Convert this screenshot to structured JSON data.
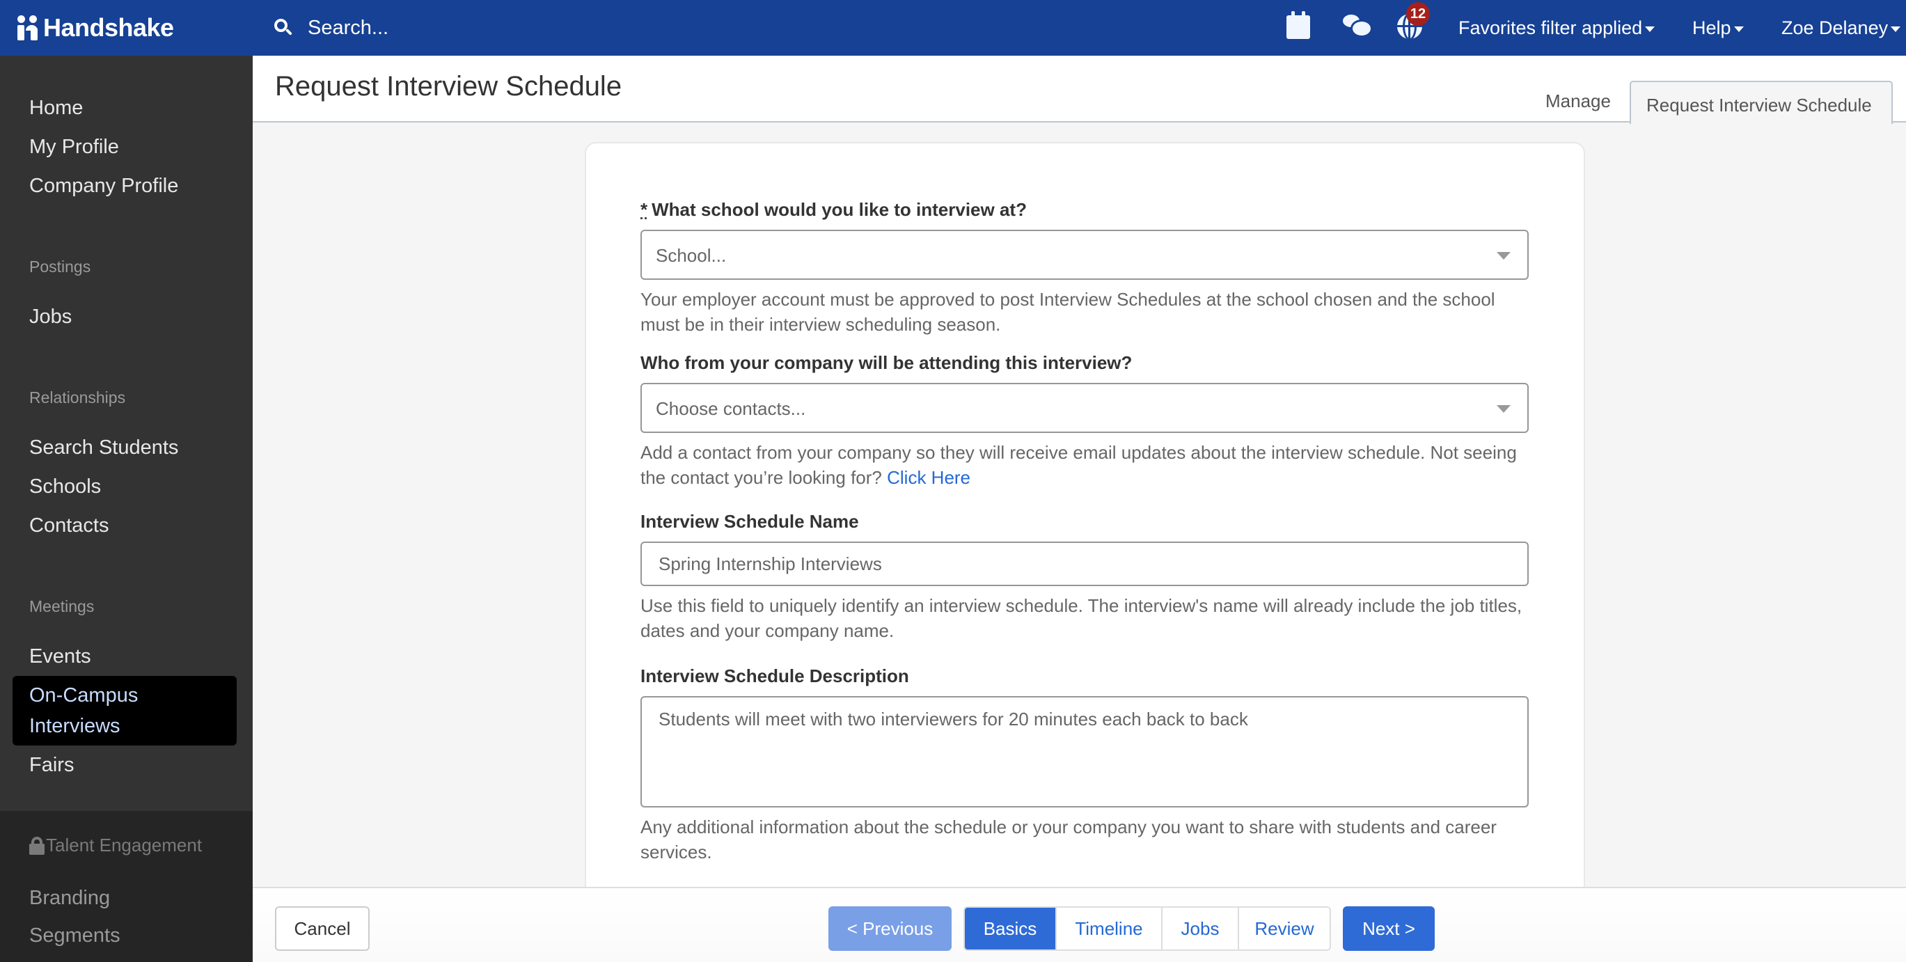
{
  "topnav": {
    "brand": "Handshake",
    "search_placeholder": "Search...",
    "notification_count": "12",
    "favorites_menu": "Favorites filter applied",
    "help_menu": "Help",
    "user_menu": "Zoe Delaney",
    "icons": [
      "calendar-icon",
      "chat-icon",
      "globe-icon"
    ],
    "brand_color": "#164194",
    "badge_color": "#a5201c"
  },
  "sidebar": {
    "top_items": [
      {
        "label": "Home"
      },
      {
        "label": "My Profile"
      },
      {
        "label": "Company Profile"
      }
    ],
    "sections": [
      {
        "heading": "Postings",
        "items": [
          {
            "label": "Jobs"
          }
        ]
      },
      {
        "heading": "Relationships",
        "items": [
          {
            "label": "Search Students"
          },
          {
            "label": "Schools"
          },
          {
            "label": "Contacts"
          }
        ]
      },
      {
        "heading": "Meetings",
        "items": [
          {
            "label": "Events"
          },
          {
            "label": "On-Campus Interviews",
            "active": true
          },
          {
            "label": "Fairs"
          }
        ]
      }
    ],
    "locked_section": {
      "heading": "Talent Engagement",
      "items": [
        {
          "label": "Branding"
        },
        {
          "label": "Segments"
        }
      ]
    }
  },
  "header": {
    "title": "Request Interview Schedule",
    "tabs": [
      {
        "label": "Manage",
        "active": false
      },
      {
        "label": "Request Interview Schedule",
        "active": true
      }
    ]
  },
  "form": {
    "school": {
      "required_mark": "*",
      "label": "What school would you like to interview at?",
      "placeholder": "School...",
      "help": "Your employer account must be approved to post Interview Schedules at the school chosen and the school must be in their interview scheduling season."
    },
    "contacts": {
      "label": "Who from your company will be attending this interview?",
      "placeholder": "Choose contacts...",
      "help": "Add a contact from your company so they will receive email updates about the interview schedule. Not seeing the contact you’re looking for?",
      "help_link": "Click Here"
    },
    "schedule_name": {
      "label": "Interview Schedule Name",
      "value": "Spring Internship Interviews",
      "help": "Use this field to uniquely identify an interview schedule. The interview's name will already include the job titles, dates and your company name."
    },
    "description": {
      "label": "Interview Schedule Description",
      "value": "Students will meet with two interviewers for 20 minutes each back to back",
      "help": "Any additional information about the schedule or your company you want to share with students and career services."
    }
  },
  "footer": {
    "cancel": "Cancel",
    "previous": "< Previous",
    "steps": [
      {
        "label": "Basics",
        "active": true
      },
      {
        "label": "Timeline",
        "active": false
      },
      {
        "label": "Jobs",
        "active": false
      },
      {
        "label": "Review",
        "active": false
      }
    ],
    "next": "Next >",
    "accent_color": "#2f6bd6"
  }
}
